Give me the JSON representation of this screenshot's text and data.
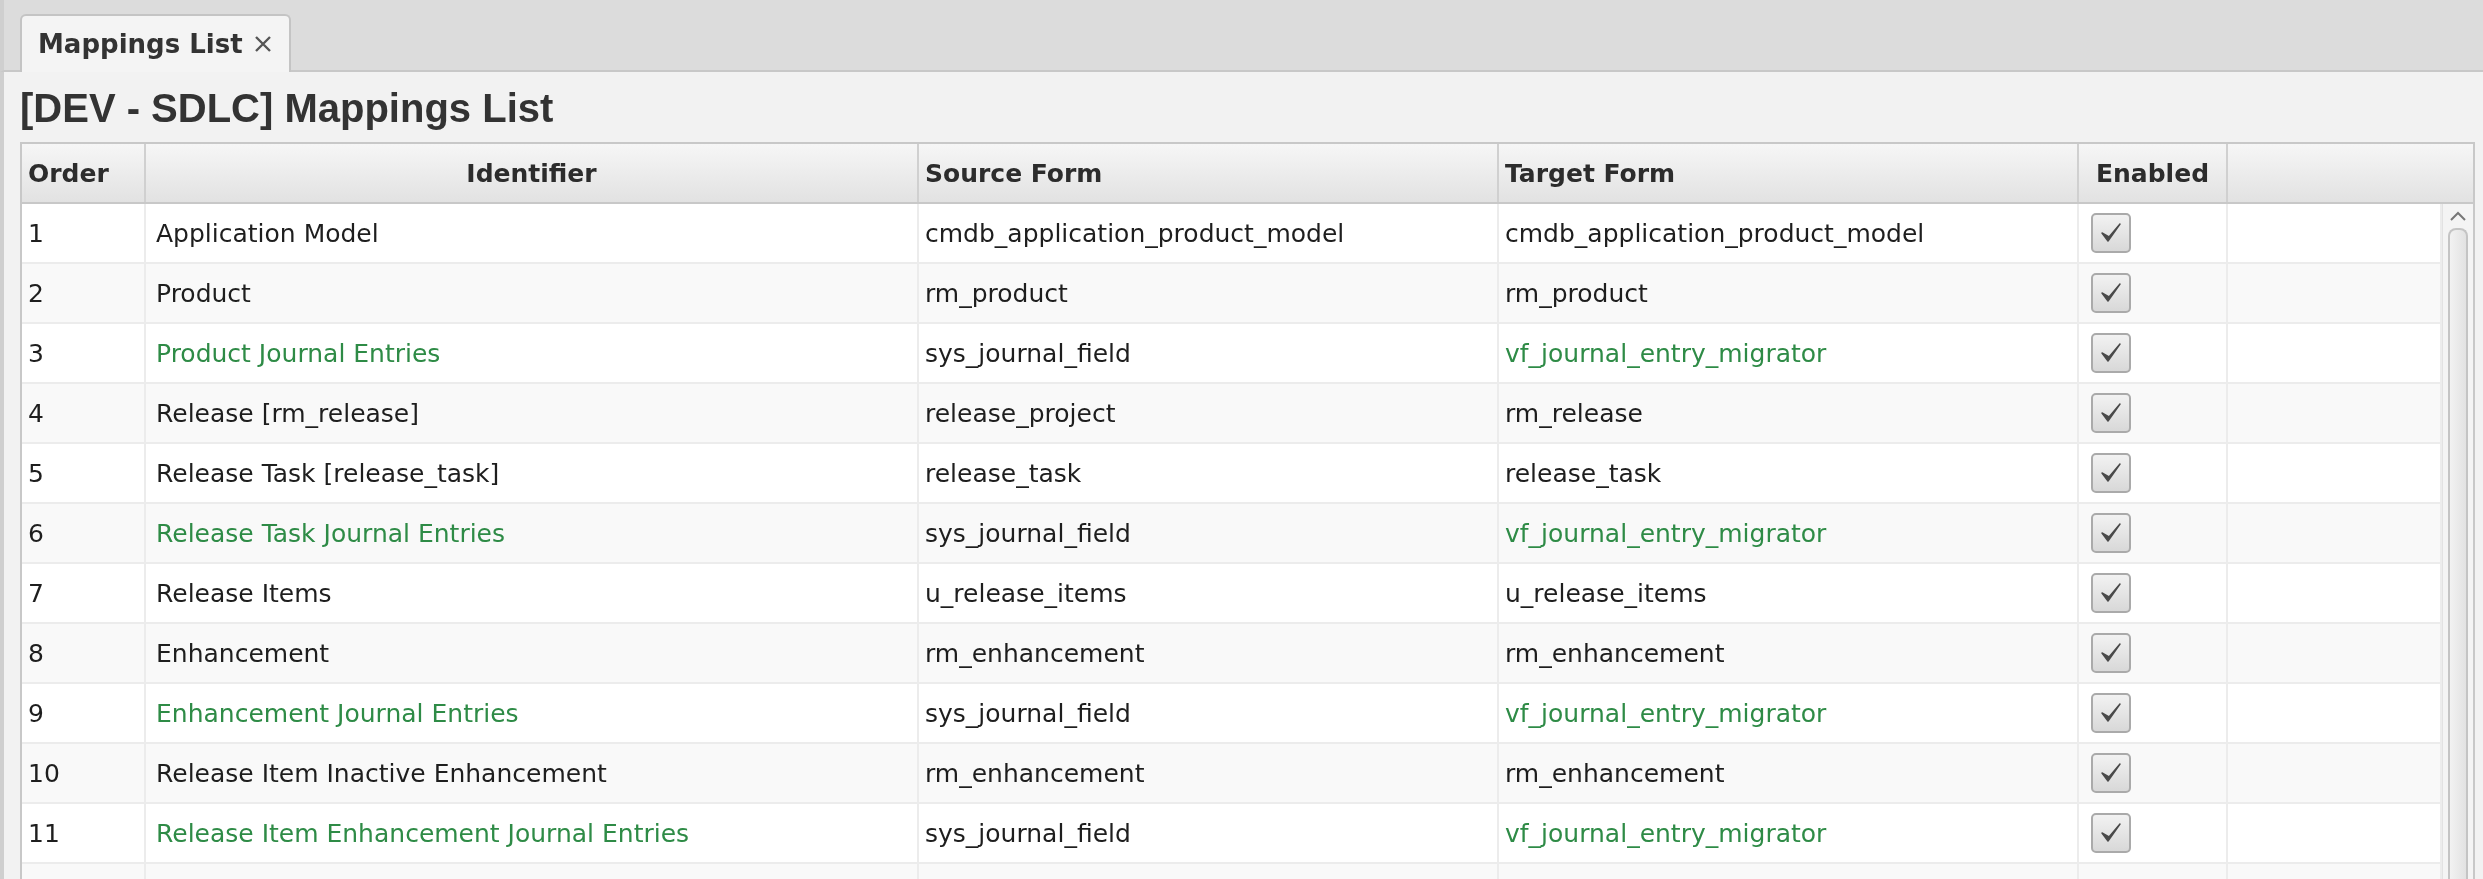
{
  "tabs": [
    {
      "label": "Mappings List",
      "selected": true
    }
  ],
  "title": "[DEV - SDLC] Mappings List",
  "table": {
    "columns": [
      "Order",
      "Identifier",
      "Source Form",
      "Target Form",
      "Enabled"
    ],
    "rows": [
      {
        "order": "1",
        "identifier": "Application Model",
        "source": "cmdb_application_product_model",
        "target": "cmdb_application_product_model",
        "kind": "plain",
        "enabled": true
      },
      {
        "order": "2",
        "identifier": "Product",
        "source": "rm_product",
        "target": "rm_product",
        "kind": "plain",
        "enabled": true
      },
      {
        "order": "3",
        "identifier": "Product Journal Entries",
        "source": "sys_journal_field",
        "target": "vf_journal_entry_migrator",
        "kind": "journal",
        "enabled": true
      },
      {
        "order": "4",
        "identifier": "Release [rm_release]",
        "source": "release_project",
        "target": "rm_release",
        "kind": "plain",
        "enabled": true
      },
      {
        "order": "5",
        "identifier": "Release Task [release_task]",
        "source": "release_task",
        "target": "release_task",
        "kind": "plain",
        "enabled": true
      },
      {
        "order": "6",
        "identifier": "Release Task Journal Entries",
        "source": "sys_journal_field",
        "target": "vf_journal_entry_migrator",
        "kind": "journal",
        "enabled": true
      },
      {
        "order": "7",
        "identifier": "Release Items",
        "source": "u_release_items",
        "target": "u_release_items",
        "kind": "plain",
        "enabled": true
      },
      {
        "order": "8",
        "identifier": "Enhancement",
        "source": "rm_enhancement",
        "target": "rm_enhancement",
        "kind": "plain",
        "enabled": true
      },
      {
        "order": "9",
        "identifier": "Enhancement Journal Entries",
        "source": "sys_journal_field",
        "target": "vf_journal_entry_migrator",
        "kind": "journal",
        "enabled": true
      },
      {
        "order": "10",
        "identifier": "Release Item Inactive Enhancement",
        "source": "rm_enhancement",
        "target": "rm_enhancement",
        "kind": "plain",
        "enabled": true
      },
      {
        "order": "11",
        "identifier": "Release Item Enhancement Journal Entries",
        "source": "sys_journal_field",
        "target": "vf_journal_entry_migrator",
        "kind": "journal",
        "enabled": true
      }
    ]
  }
}
